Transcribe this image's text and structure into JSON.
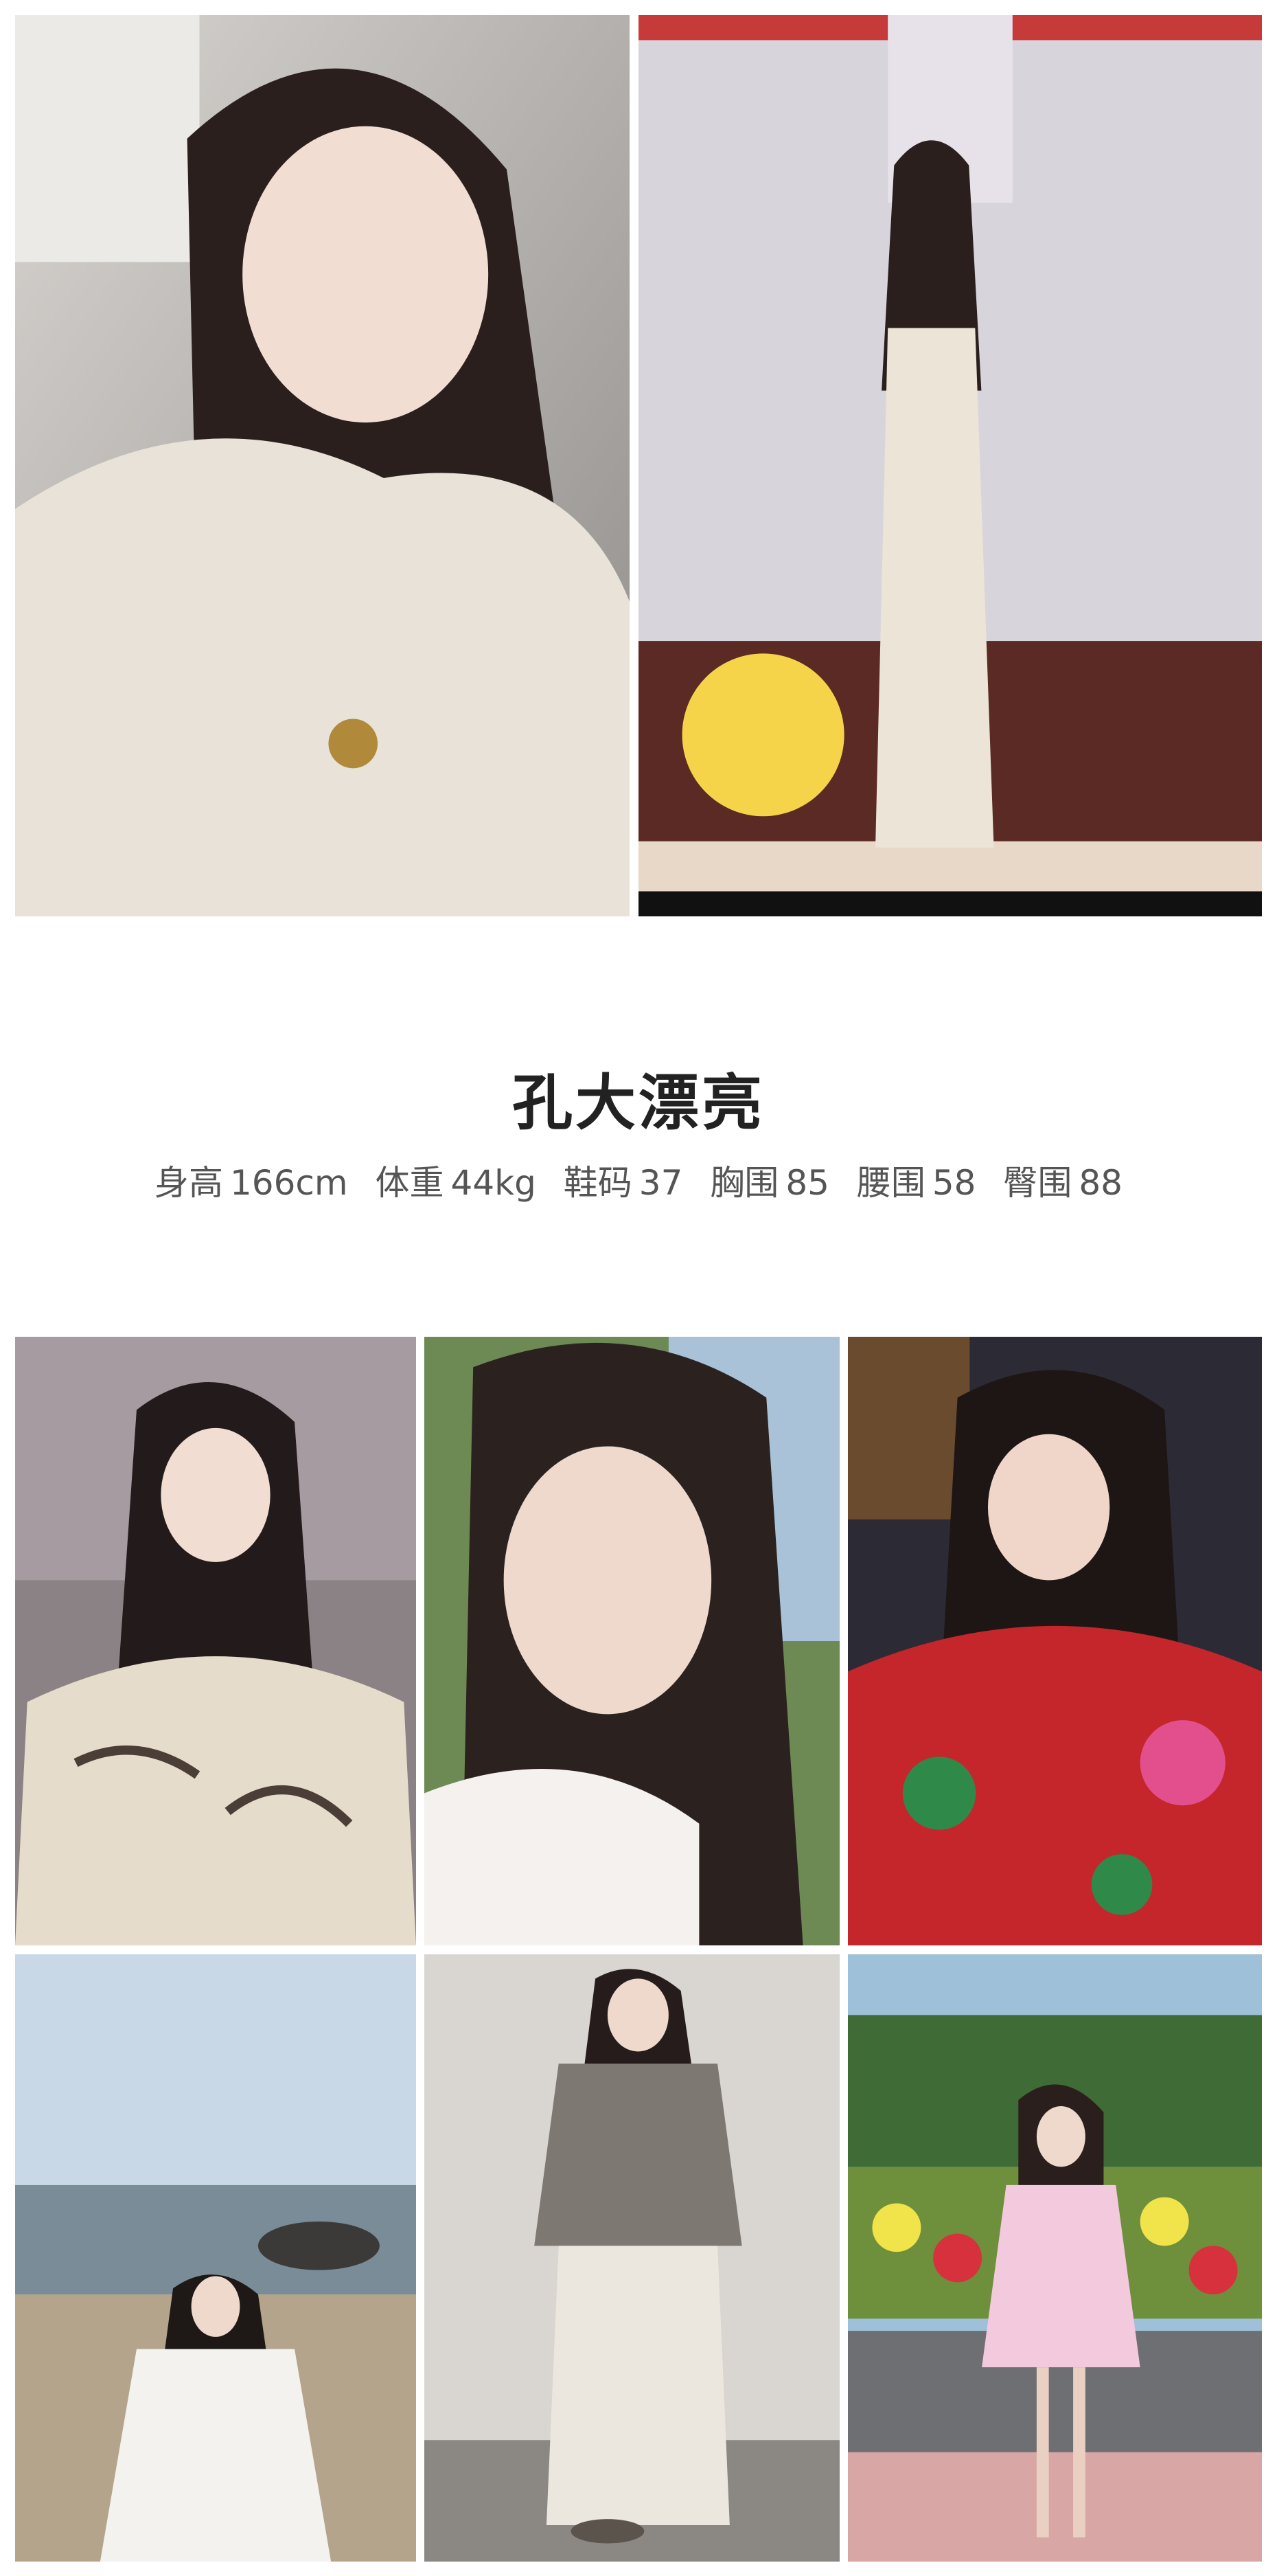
{
  "profile": {
    "name": "孔大漂亮",
    "stats": [
      {
        "label": "身高",
        "value": "166cm"
      },
      {
        "label": "体重",
        "value": "44kg"
      },
      {
        "label": "鞋码",
        "value": "37"
      },
      {
        "label": "胸围",
        "value": "85"
      },
      {
        "label": "腰围",
        "value": "58"
      },
      {
        "label": "臀围",
        "value": "88"
      }
    ]
  },
  "colors": {
    "name": "#222222",
    "stats": "#555555",
    "background": "#ffffff"
  }
}
